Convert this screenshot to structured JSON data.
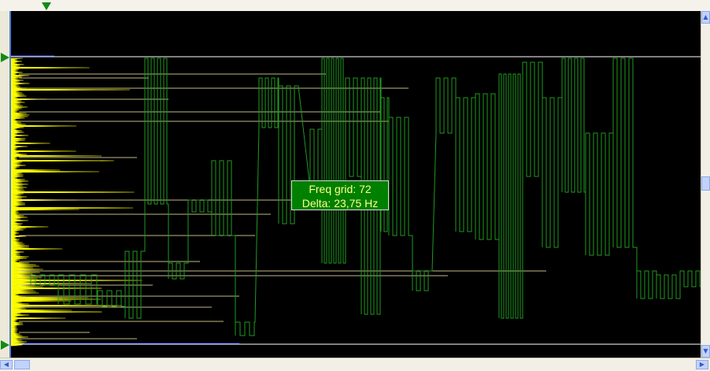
{
  "tooltip": {
    "freq_line": "Freq grid: 72",
    "delta_line": "Delta: 23,75 Hz"
  },
  "colors": {
    "background": "#000000",
    "waveform": "#1f9a1f",
    "spectrum": "#ffff00",
    "grid_line": "#ffffff",
    "marker": "#138a13",
    "tooltip_bg": "#008000",
    "tooltip_text": "#ffff8c"
  },
  "icons": {
    "top_marker": "triangle-down-marker-icon",
    "upper_marker": "triangle-right-marker-icon",
    "lower_marker": "triangle-right-marker-icon",
    "scroll_up": "arrow-up-icon",
    "scroll_down": "arrow-down-icon",
    "scroll_left": "arrow-left-icon",
    "scroll_right": "arrow-right-icon"
  }
}
